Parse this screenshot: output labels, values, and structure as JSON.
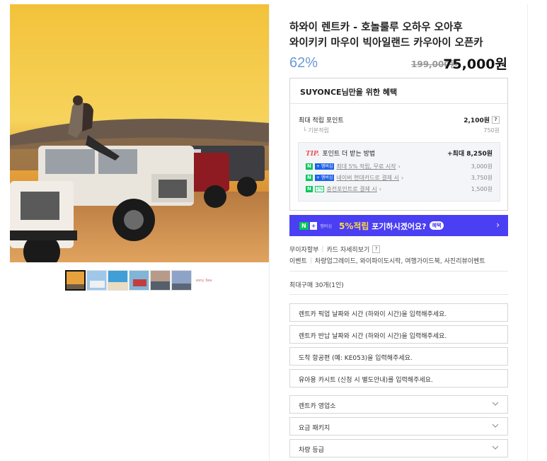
{
  "product": {
    "title_line1": "하와이 렌트카 - 호놀룰루 오하우 오아후",
    "title_line2": "와이키키 마우이 빅아일랜드 카우아이 오픈카",
    "discount": "62%",
    "original_price": "199,000원",
    "sale_price": "75,000원"
  },
  "benefits": {
    "heading": "SUYONCE님만을 위한 혜택",
    "max_points_label": "최대 적립 포인트",
    "max_points_value": "2,100원",
    "help_icon": "?",
    "basic_label": "기본적립",
    "basic_prefix": "└",
    "basic_value": "750원",
    "tip_label": "TIP.",
    "tip_text": "포인트 더 받는 방법",
    "tip_max": "+최대 8,250원",
    "tip_rows": [
      {
        "badge": "N + 멤버십",
        "text": "최대 5% 적립, 무료 시작",
        "value": "3,000원"
      },
      {
        "badge": "N + 멤버십",
        "text": "네이버 현대카드로 결제 시",
        "value": "3,750원"
      },
      {
        "badge": "N 2%",
        "text": "충전포인트로 결제 시",
        "value": "1,500원"
      }
    ]
  },
  "naver_banner": {
    "n": "N",
    "plus": "+",
    "membership": "멤버십",
    "text_highlight": "5%적립",
    "text_rest": " 포기하시겠어요?",
    "pill": "혜택",
    "arrow": "›"
  },
  "info": {
    "installment": "무이자할부",
    "card_detail": "카드 자세히보기",
    "event_label": "이벤트",
    "event_text": "차량업그레이드, 와이파이도시락, 여행가이드북, 사진리뷰이벤트",
    "max_purchase": "최대구매 30개(1인)"
  },
  "inputs": [
    {
      "placeholder": "렌트카 픽업 날짜와 시간 (하와이 시간)을 입력해주세요."
    },
    {
      "placeholder": "렌트카 반납 날짜와 시간 (하와이 시간)을 입력해주세요."
    },
    {
      "placeholder": "도착 항공편 (예: KE053)을 입력해주세요."
    },
    {
      "placeholder": "유아용 카시트 (신청 시 별도안내)를 입력해주세요."
    }
  ],
  "selects": [
    {
      "label": "렌트카 영업소"
    },
    {
      "label": "요금 패키지"
    },
    {
      "label": "차량 등급"
    }
  ],
  "thumbnails": {
    "count": 6,
    "more_text": "sony 3ea"
  },
  "colors": {
    "discount": "#6a9ad6",
    "naver_green": "#03c75a",
    "banner_purple": "#4a3ff2",
    "tip_red": "#e8505b"
  }
}
